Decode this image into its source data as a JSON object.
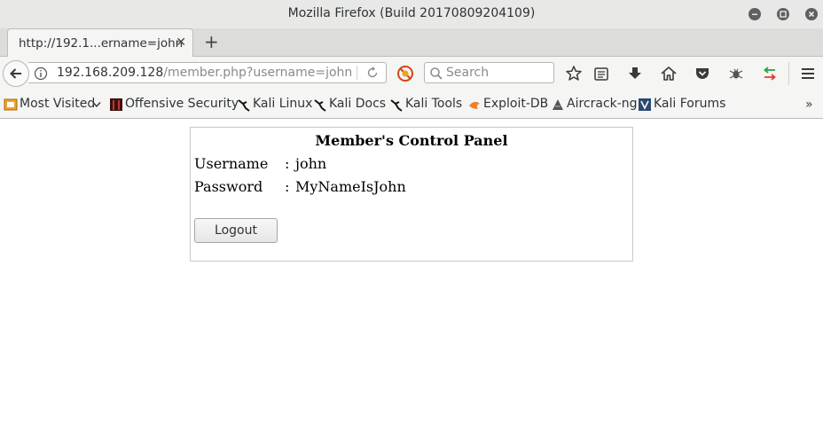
{
  "window": {
    "title": "Mozilla Firefox (Build 20170809204109)"
  },
  "tabs": [
    {
      "title": "http://192.1...ername=john"
    }
  ],
  "navbar": {
    "url_host": "192.168.209.128",
    "url_path": "/member.php?username=john",
    "search_placeholder": "Search"
  },
  "bookmarks": [
    {
      "label": "Most Visited",
      "icon": "most-visited-icon"
    },
    {
      "label": "Offensive Security",
      "icon": "offensive-security-icon"
    },
    {
      "label": "Kali Linux",
      "icon": "kali-dragon-icon"
    },
    {
      "label": "Kali Docs",
      "icon": "kali-dragon-icon"
    },
    {
      "label": "Kali Tools",
      "icon": "kali-dragon-icon"
    },
    {
      "label": "Exploit-DB",
      "icon": "exploit-db-icon"
    },
    {
      "label": "Aircrack-ng",
      "icon": "aircrack-icon"
    },
    {
      "label": "Kali Forums",
      "icon": "kali-forums-icon"
    }
  ],
  "page": {
    "panel_title": "Member's Control Panel",
    "fields": [
      {
        "label": "Username",
        "colon": ":",
        "value": "john"
      },
      {
        "label": "Password",
        "colon": ":",
        "value": "MyNameIsJohn"
      }
    ],
    "logout_label": "Logout"
  },
  "colors": {
    "chrome_bg": "#f5f5f4",
    "titlebar_bg": "#e8e8e7",
    "panel_border": "#c8c8c8"
  }
}
